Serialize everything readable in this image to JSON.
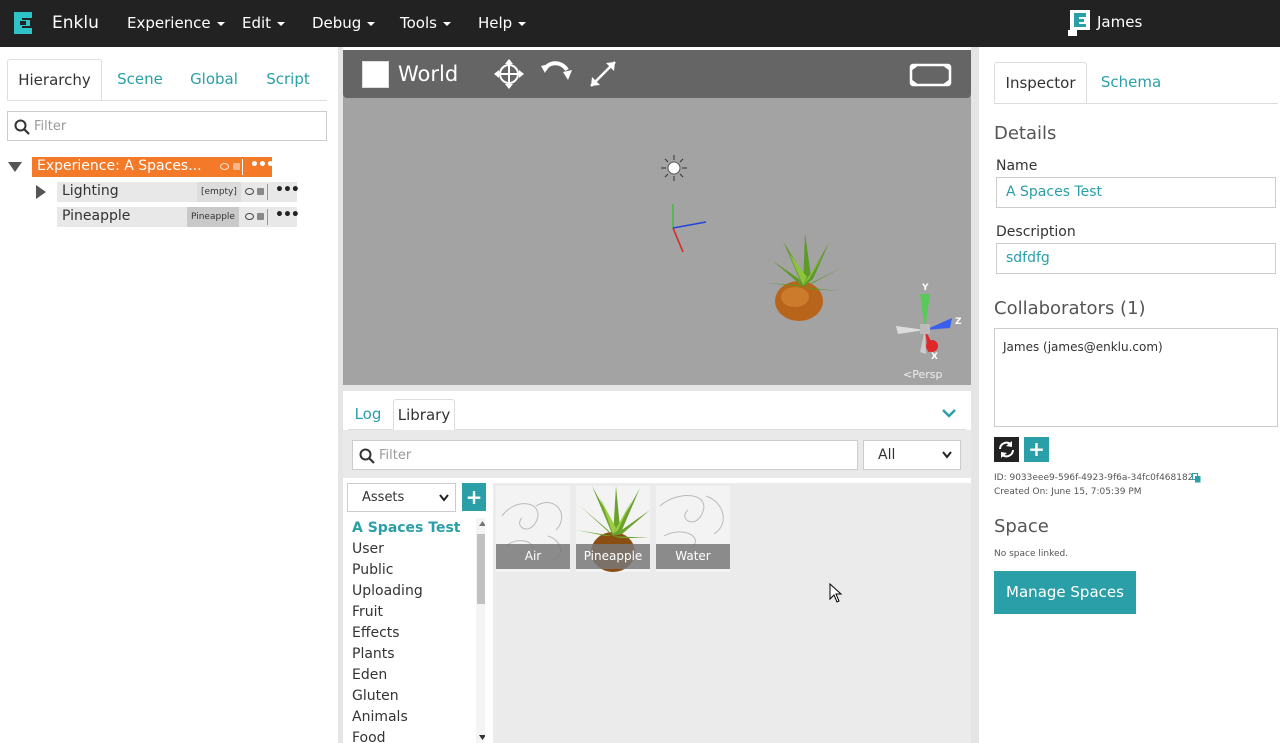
{
  "app": {
    "brand": "Enklu",
    "menu": [
      "Experience",
      "Edit",
      "Debug",
      "Tools",
      "Help"
    ],
    "user": "James"
  },
  "left": {
    "tabs": [
      "Hierarchy",
      "Scene",
      "Global",
      "Script"
    ],
    "active_tab": "Hierarchy",
    "filter_placeholder": "Filter",
    "tree": {
      "root": "Experience: A Spaces...",
      "children": [
        {
          "label": "Lighting",
          "badge": "[empty]"
        },
        {
          "label": "Pineapple",
          "badge": "Pineapple"
        }
      ]
    }
  },
  "viewport": {
    "world_label": "World",
    "camera_label": "Persp",
    "gizmo_axes": [
      "Y",
      "Z",
      "X"
    ]
  },
  "bottom": {
    "tabs": [
      "Log",
      "Library"
    ],
    "active_tab": "Library",
    "filter_placeholder": "Filter",
    "type_select": "All",
    "category_select": "Assets",
    "categories": [
      "A Spaces Test",
      "User",
      "Public",
      "Uploading",
      "Fruit",
      "Effects",
      "Plants",
      "Eden",
      "Gluten",
      "Animals",
      "Food"
    ],
    "active_category": "A Spaces Test",
    "assets": [
      "Air",
      "Pineapple",
      "Water"
    ]
  },
  "right": {
    "tabs": [
      "Inspector",
      "Schema"
    ],
    "active_tab": "Inspector",
    "details_title": "Details",
    "name_label": "Name",
    "name_value": "A Spaces Test",
    "description_label": "Description",
    "description_value": "sdfdfg",
    "collaborators_title": "Collaborators (1)",
    "collaborators": [
      "James (james@enklu.com)"
    ],
    "id_text": "ID: 9033eee9-596f-4923-9f6a-34fc0f468182",
    "created_text": "Created On: June 15, 7:05:39 PM",
    "space_title": "Space",
    "space_status": "No space linked.",
    "manage_button": "Manage Spaces"
  },
  "colors": {
    "topbar": "#222222",
    "accent": "#2a9fa8",
    "selected_node": "#f47a2a",
    "viewport_bg": "#a3a3a3"
  }
}
